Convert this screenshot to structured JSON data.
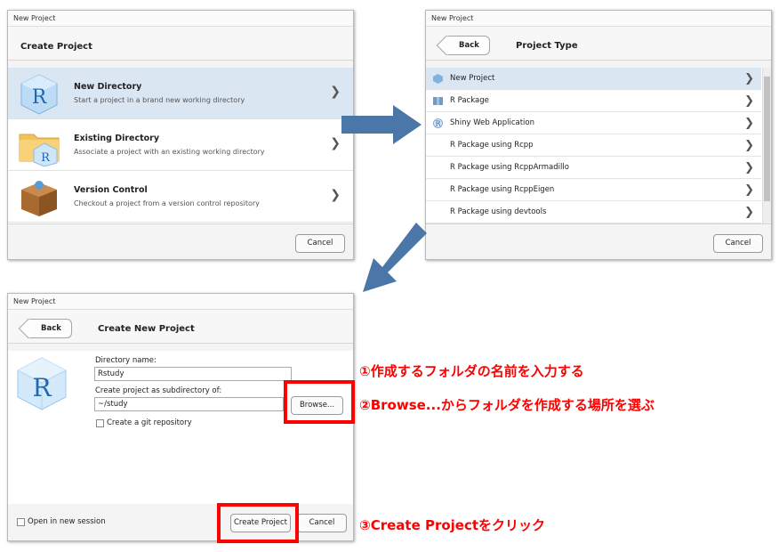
{
  "create_project": {
    "window_title": "New Project",
    "title": "Create Project",
    "options": [
      {
        "name": "New Directory",
        "desc": "Start a project in a brand new working directory",
        "icon": "r-cube-icon"
      },
      {
        "name": "Existing Directory",
        "desc": "Associate a project with an existing working directory",
        "icon": "folder-r-icon"
      },
      {
        "name": "Version Control",
        "desc": "Checkout a project from a version control repository",
        "icon": "box-icon"
      }
    ],
    "cancel_label": "Cancel"
  },
  "project_type": {
    "window_title": "New Project",
    "back_label": "Back",
    "title": "Project Type",
    "items": [
      {
        "label": "New Project"
      },
      {
        "label": "R Package"
      },
      {
        "label": "Shiny Web Application"
      },
      {
        "label": "R Package using Rcpp"
      },
      {
        "label": "R Package using RcppArmadillo"
      },
      {
        "label": "R Package using RcppEigen"
      },
      {
        "label": "R Package using devtools"
      }
    ],
    "cancel_label": "Cancel"
  },
  "create_new_project": {
    "window_title": "New Project",
    "back_label": "Back",
    "title": "Create New Project",
    "dir_name_label": "Directory name:",
    "dir_name_value": "Rstudy",
    "subdir_label": "Create project as subdirectory of:",
    "subdir_value": "~/study",
    "browse_label": "Browse...",
    "git_label": "Create a git repository",
    "open_session_label": "Open in new session",
    "create_label": "Create Project",
    "cancel_label": "Cancel"
  },
  "annotations": {
    "step1": "①作成するフォルダの名前を入力する",
    "step2": "②Browse...からフォルダを作成する場所を選ぶ",
    "step3": "③Create Projectをクリック"
  },
  "colors": {
    "selected_row": "#dbe6f3",
    "arrow": "#4a76a8",
    "annotation_red": "#ff0000"
  }
}
